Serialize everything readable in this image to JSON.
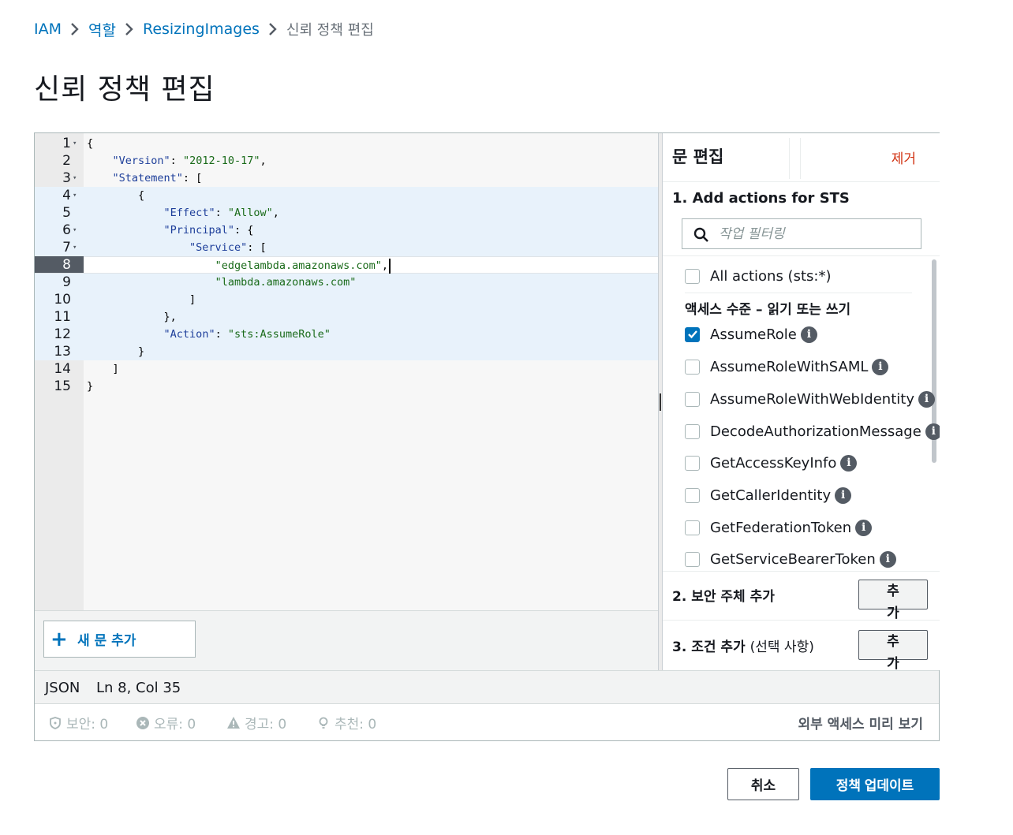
{
  "breadcrumb": {
    "items": [
      "IAM",
      "역할",
      "ResizingImages"
    ],
    "current": "신뢰 정책 편집"
  },
  "page_title": "신뢰 정책 편집",
  "editor": {
    "lines": [
      {
        "num": "1",
        "fold": true
      },
      {
        "num": "2",
        "fold": false
      },
      {
        "num": "3",
        "fold": true
      },
      {
        "num": "4",
        "fold": true
      },
      {
        "num": "5",
        "fold": false
      },
      {
        "num": "6",
        "fold": true
      },
      {
        "num": "7",
        "fold": true
      },
      {
        "num": "8",
        "fold": false
      },
      {
        "num": "9",
        "fold": false
      },
      {
        "num": "10",
        "fold": false
      },
      {
        "num": "11",
        "fold": false
      },
      {
        "num": "12",
        "fold": false
      },
      {
        "num": "13",
        "fold": false
      },
      {
        "num": "14",
        "fold": false
      },
      {
        "num": "15",
        "fold": false
      }
    ],
    "code": {
      "l1": "{",
      "l2_key": "\"Version\"",
      "l2_val": "\"2012-10-17\"",
      "l3_key": "\"Statement\"",
      "l3_rest": ": [",
      "l4": "{",
      "l5_key": "\"Effect\"",
      "l5_val": "\"Allow\"",
      "l6_key": "\"Principal\"",
      "l6_rest": ": {",
      "l7_key": "\"Service\"",
      "l7_rest": ": [",
      "l8_val": "\"edgelambda.amazonaws.com\"",
      "l9_val": "\"lambda.amazonaws.com\"",
      "l10": "]",
      "l11": "},",
      "l12_key": "\"Action\"",
      "l12_val": "\"sts:AssumeRole\"",
      "l13": "}",
      "l14": "]",
      "l15": "}"
    },
    "add_statement_label": "새 문 추가"
  },
  "panel": {
    "title": "문 편집",
    "remove_label": "제거",
    "section1_title": "1. Add actions for STS",
    "filter_placeholder": "작업 필터링",
    "all_actions_label": "All actions (sts:*)",
    "access_level_label": "액세스 수준 – 읽기 또는 쓰기",
    "actions": [
      {
        "label": "AssumeRole",
        "checked": true
      },
      {
        "label": "AssumeRoleWithSAML",
        "checked": false
      },
      {
        "label": "AssumeRoleWithWebIdentity",
        "checked": false
      },
      {
        "label": "DecodeAuthorizationMessage",
        "checked": false
      },
      {
        "label": "GetAccessKeyInfo",
        "checked": false
      },
      {
        "label": "GetCallerIdentity",
        "checked": false
      },
      {
        "label": "GetFederationToken",
        "checked": false
      },
      {
        "label": "GetServiceBearerToken",
        "checked": false
      }
    ],
    "section2_title": "2. 보안 주체 추가",
    "section3_title": "3. 조건 추가",
    "section3_optional": "(선택 사항)",
    "add_label": "추가"
  },
  "status": {
    "mode": "JSON",
    "position": "Ln 8, Col 35",
    "security": "보안: 0",
    "errors": "오류: 0",
    "warnings": "경고: 0",
    "suggestions": "추천: 0",
    "preview_label": "외부 액세스 미리 보기"
  },
  "footer": {
    "cancel_label": "취소",
    "update_label": "정책 업데이트"
  },
  "colors": {
    "link": "#0073bb",
    "primary": "#0073bb",
    "danger": "#d13212",
    "json_key": "#1d3e9a",
    "json_string": "#1a6b1a"
  }
}
